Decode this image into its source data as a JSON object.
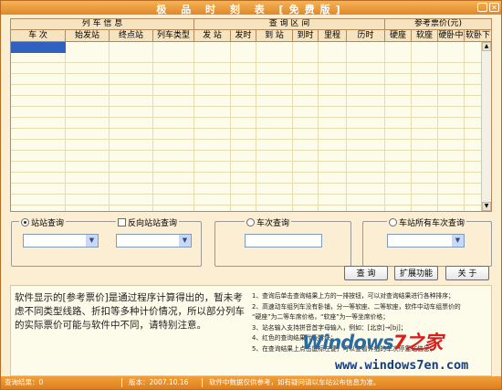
{
  "window": {
    "title": "极 品 时 刻 表 [免费版]",
    "minimize_icon": "minimize-icon",
    "close_icon": "close-icon"
  },
  "table": {
    "groups": [
      "列 车 信 息",
      "查 询 区 间",
      "参考票价(元)"
    ],
    "columns": [
      "车 次",
      "始发站",
      "终点站",
      "列车类型",
      "发 站",
      "发时",
      "到 站",
      "到时",
      "里程",
      "历时",
      "硬座",
      "软座",
      "硬卧中",
      "软卧下"
    ],
    "rows": []
  },
  "search": {
    "station": {
      "label": "站站查询",
      "selected": true
    },
    "reverse": {
      "label": "反向站站查询",
      "checked": false
    },
    "from_station": {
      "value": ""
    },
    "to_station": {
      "value": ""
    },
    "train": {
      "label": "车次查询",
      "selected": false,
      "value": ""
    },
    "all_trains": {
      "label": "车站所有车次查询",
      "selected": false,
      "value": ""
    }
  },
  "buttons": {
    "query": "查 询",
    "extend": "扩展功能",
    "about": "关 于"
  },
  "info": {
    "note": "软件显示的[参考票价]是通过程序计算得出的，暂未考虑不同类型线路、折扣等多种计价情况，所以部分列车的实际票价可能与软件中不同，请特别注意。",
    "steps": [
      "1、查询后单击查询结果上方的一排按钮，可以对查询结果进行各种排序；",
      "2、高速动车组列车没有卧铺，分一等软座、二等软座，软件中动车组票价的",
      "  “硬座”为二等车席价格，“软座”为一等坐席价格；",
      "3、站名输入支持拼音首字母输入，例如：[北京]→[bj]；",
      "4、红色的查询结果代表特快；",
      "5、在查询结果上点击鼠标左键，可以查看详细的车次停靠站信息；"
    ]
  },
  "watermark": {
    "line1_a": "Windows",
    "line1_b": "7之家",
    "line2": "www.windows7en.com"
  },
  "status": {
    "count": "查询结果：0",
    "version": "版本：2007.10.16",
    "disclaimer": "软件中数据仅供参考，如有疑问请以车站公布信息为准。"
  }
}
